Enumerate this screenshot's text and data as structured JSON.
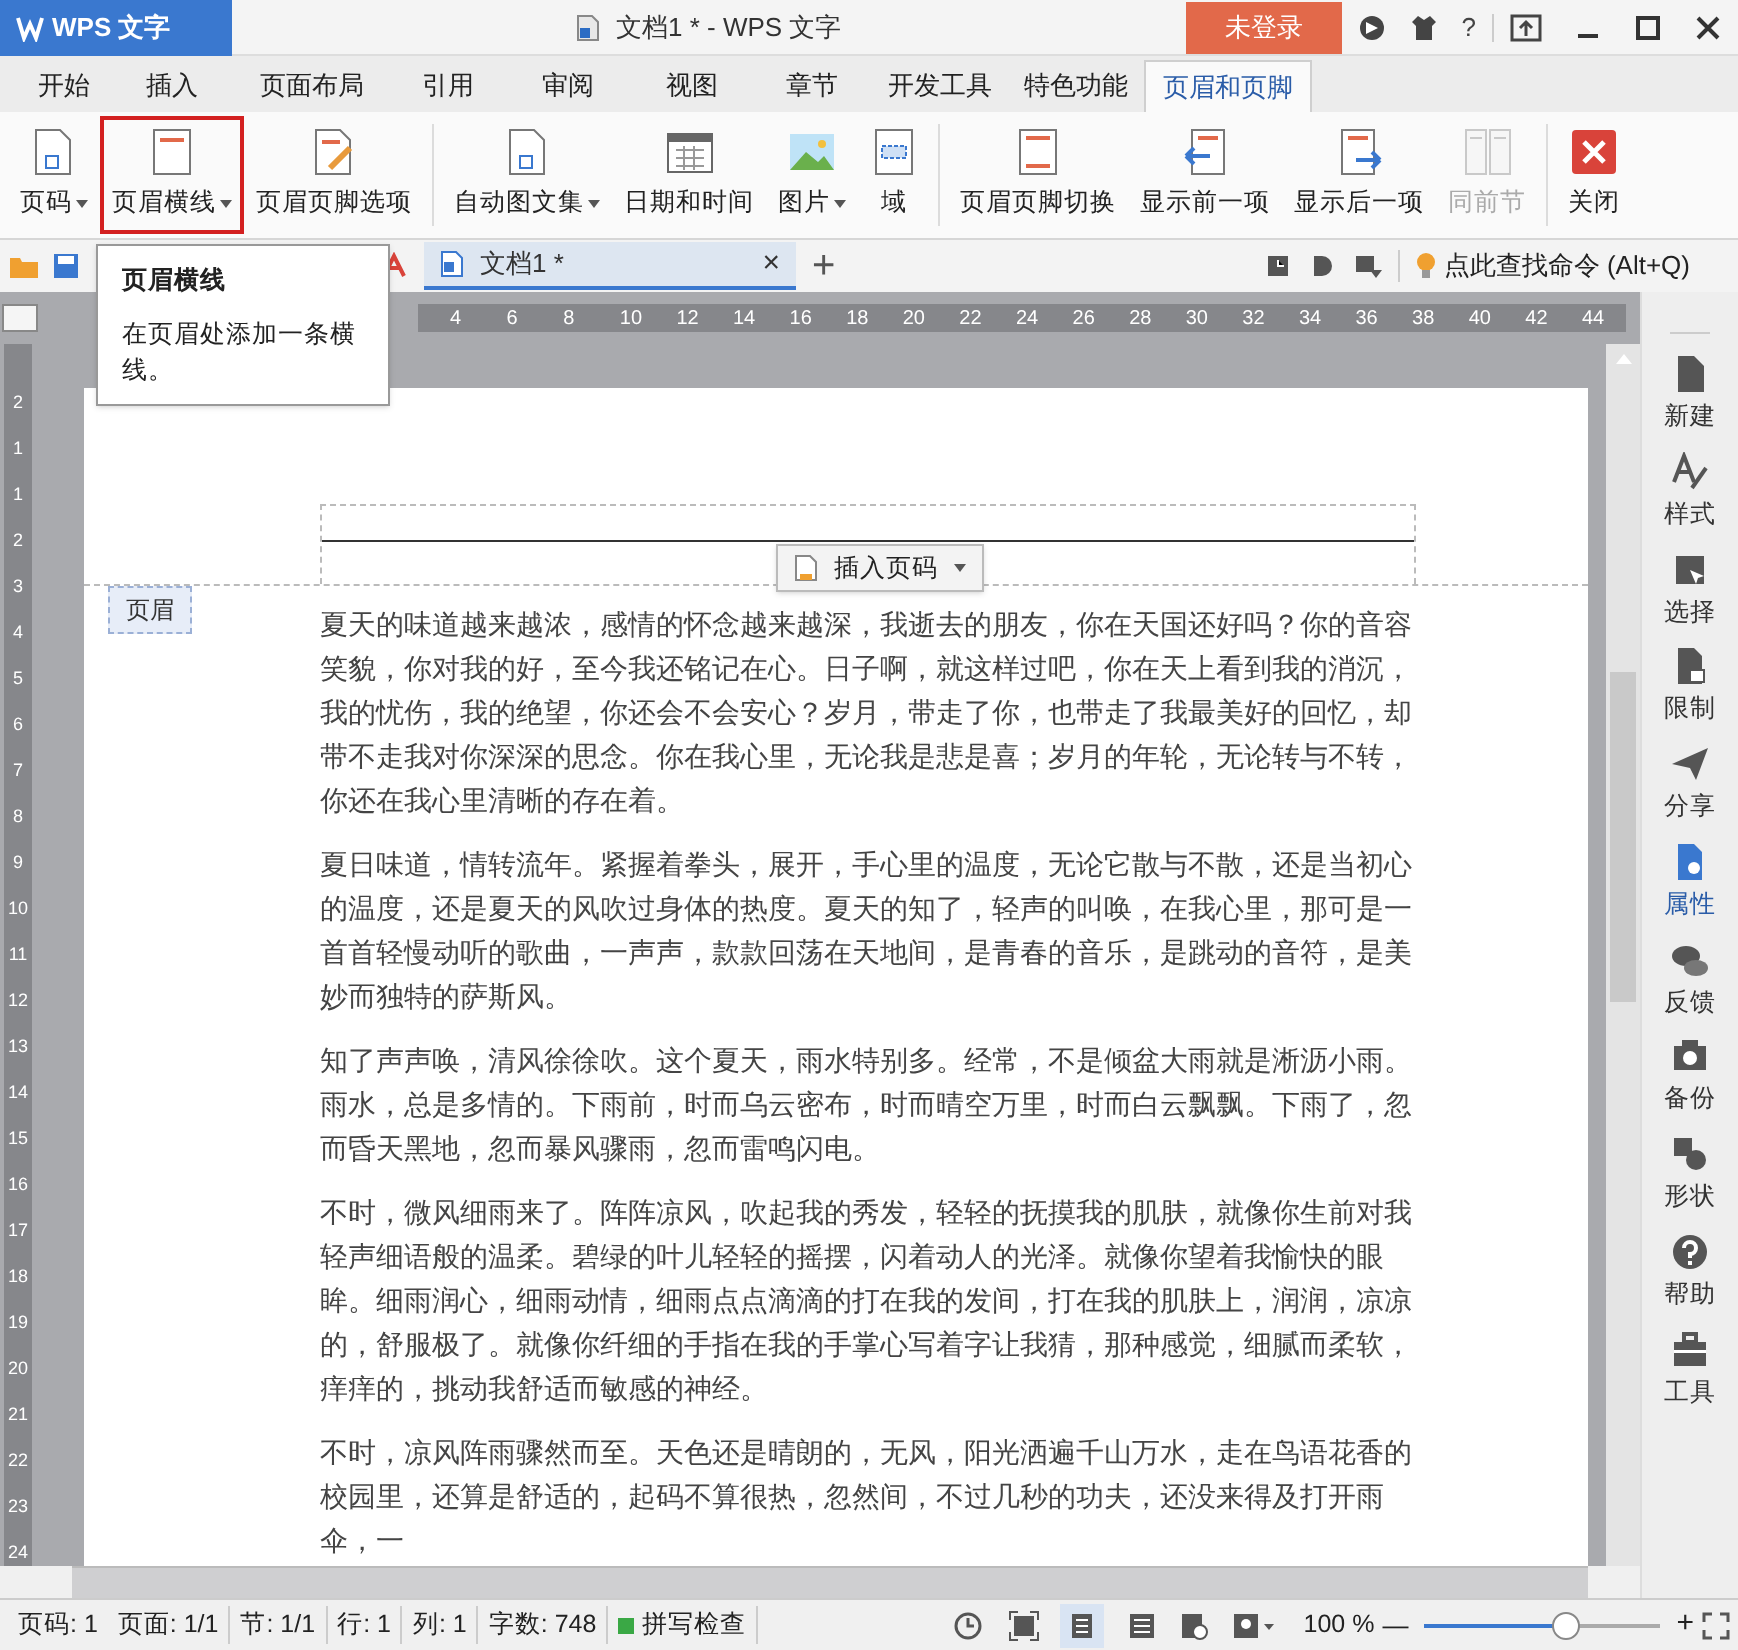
{
  "title_bar": {
    "app_button": "WPS 文字",
    "title": "文档1 * - WPS 文字",
    "login_button": "未登录",
    "help_label": "?"
  },
  "tabs": [
    {
      "label": "开始",
      "selected": false
    },
    {
      "label": "插入",
      "selected": false
    },
    {
      "label": "页面布局",
      "selected": false
    },
    {
      "label": "引用",
      "selected": false
    },
    {
      "label": "审阅",
      "selected": false
    },
    {
      "label": "视图",
      "selected": false
    },
    {
      "label": "章节",
      "selected": false
    },
    {
      "label": "开发工具",
      "selected": false
    },
    {
      "label": "特色功能",
      "selected": false
    },
    {
      "label": "页眉和页脚",
      "selected": true
    }
  ],
  "ribbon": [
    {
      "kind": "page",
      "label": "页码",
      "dropdown": true,
      "selected": false,
      "disabled": false
    },
    {
      "kind": "line",
      "label": "页眉横线",
      "dropdown": true,
      "selected": true,
      "disabled": false
    },
    {
      "kind": "options",
      "label": "页眉页脚选项",
      "dropdown": false,
      "selected": false,
      "disabled": false
    },
    {
      "kind": "page",
      "label": "自动图文集",
      "dropdown": true,
      "selected": false,
      "disabled": false
    },
    {
      "kind": "calendar",
      "label": "日期和时间",
      "dropdown": false,
      "selected": false,
      "disabled": false
    },
    {
      "kind": "picture",
      "label": "图片",
      "dropdown": true,
      "selected": false,
      "disabled": false
    },
    {
      "kind": "field",
      "label": "域",
      "dropdown": false,
      "selected": false,
      "disabled": false
    },
    {
      "kind": "switch",
      "label": "页眉页脚切换",
      "dropdown": false,
      "selected": false,
      "disabled": false
    },
    {
      "kind": "prev",
      "label": "显示前一项",
      "dropdown": false,
      "selected": false,
      "disabled": false
    },
    {
      "kind": "next",
      "label": "显示后一项",
      "dropdown": false,
      "selected": false,
      "disabled": false
    },
    {
      "kind": "same",
      "label": "同前节",
      "dropdown": false,
      "selected": false,
      "disabled": true
    },
    {
      "kind": "close",
      "label": "关闭",
      "dropdown": false,
      "selected": false,
      "disabled": false
    }
  ],
  "doc_tab": {
    "label": "文档1 *",
    "close": "×",
    "new_tab": "+"
  },
  "command_search": "点此查找命令 (Alt+Q)",
  "tooltip": {
    "title": "页眉横线",
    "body": "在页眉处添加一条横线。"
  },
  "ruler": {
    "ticks": [
      "4",
      "6",
      "8",
      "10",
      "12",
      "14",
      "16",
      "18",
      "20",
      "22",
      "24",
      "26",
      "28",
      "30",
      "32",
      "34",
      "36",
      "38",
      "40",
      "42",
      "44"
    ]
  },
  "vertical_ruler": {
    "ticks": [
      "2",
      "1",
      "1",
      "2",
      "3",
      "4",
      "5",
      "6",
      "7",
      "8",
      "9",
      "10",
      "11",
      "12",
      "13",
      "14",
      "15",
      "16",
      "17",
      "18",
      "19",
      "20",
      "21",
      "22",
      "23",
      "24"
    ]
  },
  "document": {
    "header_label": "页眉",
    "insert_page_number": "插入页码",
    "paragraphs": [
      "夏天的味道越来越浓，感情的怀念越来越深，我逝去的朋友，你在天国还好吗？你的音容笑貌，你对我的好，至今我还铭记在心。日子啊，就这样过吧，你在天上看到我的消沉，我的忧伤，我的绝望，你还会不会安心？岁月，带走了你，也带走了我最美好的回忆，却带不走我对你深深的思念。你在我心里，无论我是悲是喜；岁月的年轮，无论转与不转，你还在我心里清晰的存在着。",
      "夏日味道，情转流年。紧握着拳头，展开，手心里的温度，无论它散与不散，还是当初心的温度，还是夏天的风吹过身体的热度。夏天的知了，轻声的叫唤，在我心里，那可是一首首轻慢动听的歌曲，一声声，款款回荡在天地间，是青春的音乐，是跳动的音符，是美妙而独特的萨斯风。",
      "知了声声唤，清风徐徐吹。这个夏天，雨水特别多。经常，不是倾盆大雨就是淅沥小雨。雨水，总是多情的。下雨前，时而乌云密布，时而晴空万里，时而白云飘飘。下雨了，忽而昏天黑地，忽而暴风骤雨，忽而雷鸣闪电。",
      "不时，微风细雨来了。阵阵凉风，吹起我的秀发，轻轻的抚摸我的肌肤，就像你生前对我轻声细语般的温柔。碧绿的叶儿轻轻的摇摆，闪着动人的光泽。就像你望着我愉快的眼眸。细雨润心，细雨动情，细雨点点滴滴的打在我的发间，打在我的肌肤上，润润，凉凉的，舒服极了。就像你纤细的手指在我的手掌心写着字让我猜，那种感觉，细腻而柔软，痒痒的，挑动我舒适而敏感的神经。",
      "不时，凉风阵雨骤然而至。天色还是晴朗的，无风，阳光洒遍千山万水，走在鸟语花香的校园里，还算是舒适的，起码不算很热，忽然间，不过几秒的功夫，还没来得及打开雨伞，一"
    ]
  },
  "sidebar": [
    {
      "label": "新建",
      "kind": "new",
      "selected": false
    },
    {
      "label": "样式",
      "kind": "style",
      "selected": false
    },
    {
      "label": "选择",
      "kind": "select",
      "selected": false
    },
    {
      "label": "限制",
      "kind": "lock",
      "selected": false
    },
    {
      "label": "分享",
      "kind": "share",
      "selected": false
    },
    {
      "label": "属性",
      "kind": "props",
      "selected": true
    },
    {
      "label": "反馈",
      "kind": "chat",
      "selected": false
    },
    {
      "label": "备份",
      "kind": "backup",
      "selected": false
    },
    {
      "label": "形状",
      "kind": "shape",
      "selected": false
    },
    {
      "label": "帮助",
      "kind": "help",
      "selected": false
    },
    {
      "label": "工具",
      "kind": "tools",
      "selected": false
    }
  ],
  "status_bar": {
    "items": [
      "页码: 1",
      "页面: 1/1",
      "节: 1/1",
      "行: 1",
      "列: 1",
      "字数: 748"
    ],
    "spell_check": "拼写检查",
    "zoom": "100 %",
    "zoom_minus": "—",
    "zoom_plus": "+",
    "zoom_slider": {
      "level": 0.6
    }
  }
}
